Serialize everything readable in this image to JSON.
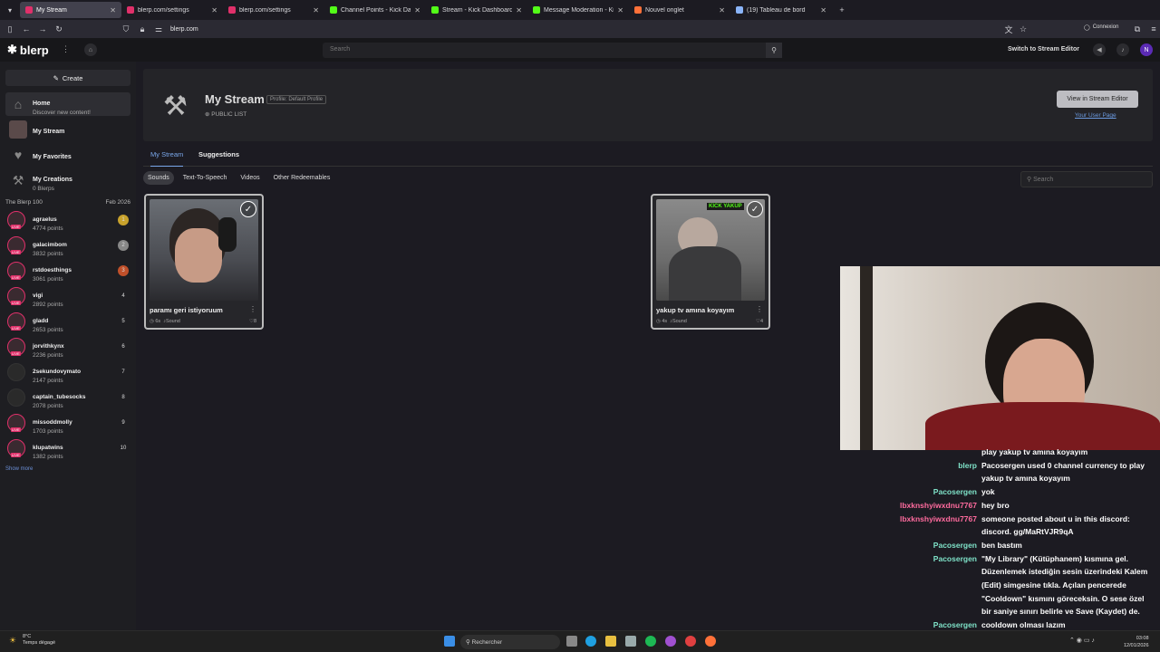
{
  "browser": {
    "tabs": [
      {
        "title": "My Stream",
        "color": "#e0306a",
        "active": true
      },
      {
        "title": "blerp.com/settings",
        "color": "#e0306a"
      },
      {
        "title": "blerp.com/settings",
        "color": "#e0306a"
      },
      {
        "title": "Channel Points - Kick Dashboa",
        "color": "#53fc18"
      },
      {
        "title": "Stream - Kick Dashboard",
        "color": "#53fc18"
      },
      {
        "title": "Message Moderation - Kick Da",
        "color": "#53fc18"
      },
      {
        "title": "Nouvel onglet",
        "color": "#ff7139"
      },
      {
        "title": "(19) Tableau de bord",
        "color": "#8ab4f8"
      }
    ],
    "url": "blerp.com",
    "connexion": "Connexion"
  },
  "header": {
    "logo": "blerp",
    "search_placeholder": "Search",
    "switch_label": "Switch to Stream Editor"
  },
  "sidebar": {
    "create": "Create",
    "nav": [
      {
        "label": "Home",
        "sub": "Discover new content!"
      },
      {
        "label": "My Stream",
        "sub": ""
      },
      {
        "label": "My Favorites",
        "sub": ""
      },
      {
        "label": "My Creations",
        "sub": "0 Blerps"
      }
    ],
    "b100_title": "The Blerp 100",
    "b100_date": "Feb 2026",
    "leaders": [
      {
        "name": "agraelus",
        "points": "4774 points",
        "rank": "1",
        "live": true
      },
      {
        "name": "galacimbom",
        "points": "3832 points",
        "rank": "2",
        "live": true
      },
      {
        "name": "rstdoesthings",
        "points": "3061 points",
        "rank": "3",
        "live": true
      },
      {
        "name": "vigi",
        "points": "2892 points",
        "rank": "4",
        "live": true
      },
      {
        "name": "gladd",
        "points": "2653 points",
        "rank": "5",
        "live": true
      },
      {
        "name": "jorvithkynx",
        "points": "2236 points",
        "rank": "6",
        "live": true
      },
      {
        "name": "2sekundovymato",
        "points": "2147 points",
        "rank": "7",
        "live": false
      },
      {
        "name": "captain_tubesocks",
        "points": "2078 points",
        "rank": "8",
        "live": false
      },
      {
        "name": "missoddmolly",
        "points": "1703 points",
        "rank": "9",
        "live": true
      },
      {
        "name": "klupatwins",
        "points": "1382 points",
        "rank": "10",
        "live": true
      }
    ],
    "show_more": "Show more"
  },
  "hero": {
    "title": "My Stream",
    "profile": "Profile: Default Profile",
    "visibility": "PUBLIC LIST",
    "view_button": "View in Stream Editor",
    "user_page": "Your User Page"
  },
  "tabs": {
    "my_stream": "My Stream",
    "suggestions": "Suggestions"
  },
  "filters": [
    "Sounds",
    "Text-To-Speech",
    "Videos",
    "Other Redeemables"
  ],
  "filter_search": "Search",
  "cards": [
    {
      "title": "paramı geri istiyoruum",
      "duration": "6s",
      "type": "Sound",
      "likes": "8"
    },
    {
      "title": "yakup tv amına koyayım",
      "duration": "4s",
      "type": "Sound",
      "likes": "4",
      "badge": "KICK YAKUP"
    }
  ],
  "chat": [
    {
      "user": "",
      "text": "play yakup tv amına koyayım",
      "color": "#ffffff"
    },
    {
      "user": "blerp",
      "text": "Pacosergen used 0 channel currency to play yakup tv amına koyayım",
      "color": "#7fe3c9"
    },
    {
      "user": "Pacosergen",
      "text": "yok",
      "color": "#7fe3c9"
    },
    {
      "user": "lbxknshyiwxdnu7767",
      "text": "hey bro",
      "color": "#ff6b9e"
    },
    {
      "user": "lbxknshyiwxdnu7767",
      "text": "someone posted about u in this discord: discord. gg/MaRtVJR9qA",
      "color": "#ff6b9e"
    },
    {
      "user": "Pacosergen",
      "text": "ben bastım",
      "color": "#7fe3c9"
    },
    {
      "user": "Pacosergen",
      "text": "\"My Library\" (Kütüphanem) kısmına gel. Düzenlemek istediğin sesin üzerindeki Kalem (Edit) simgesine tıkla. Açılan pencerede \"Cooldown\" kısmını göreceksin. O sese özel bir saniye sınırı belirle ve Save (Kaydet) de.",
      "color": "#7fe3c9"
    },
    {
      "user": "Pacosergen",
      "text": "cooldown olması lazım",
      "color": "#7fe3c9"
    }
  ],
  "taskbar": {
    "search": "Rechercher",
    "temp": "8°C",
    "weather": "Temps dégagé",
    "time": "03:08",
    "date": "12/01/2026"
  }
}
